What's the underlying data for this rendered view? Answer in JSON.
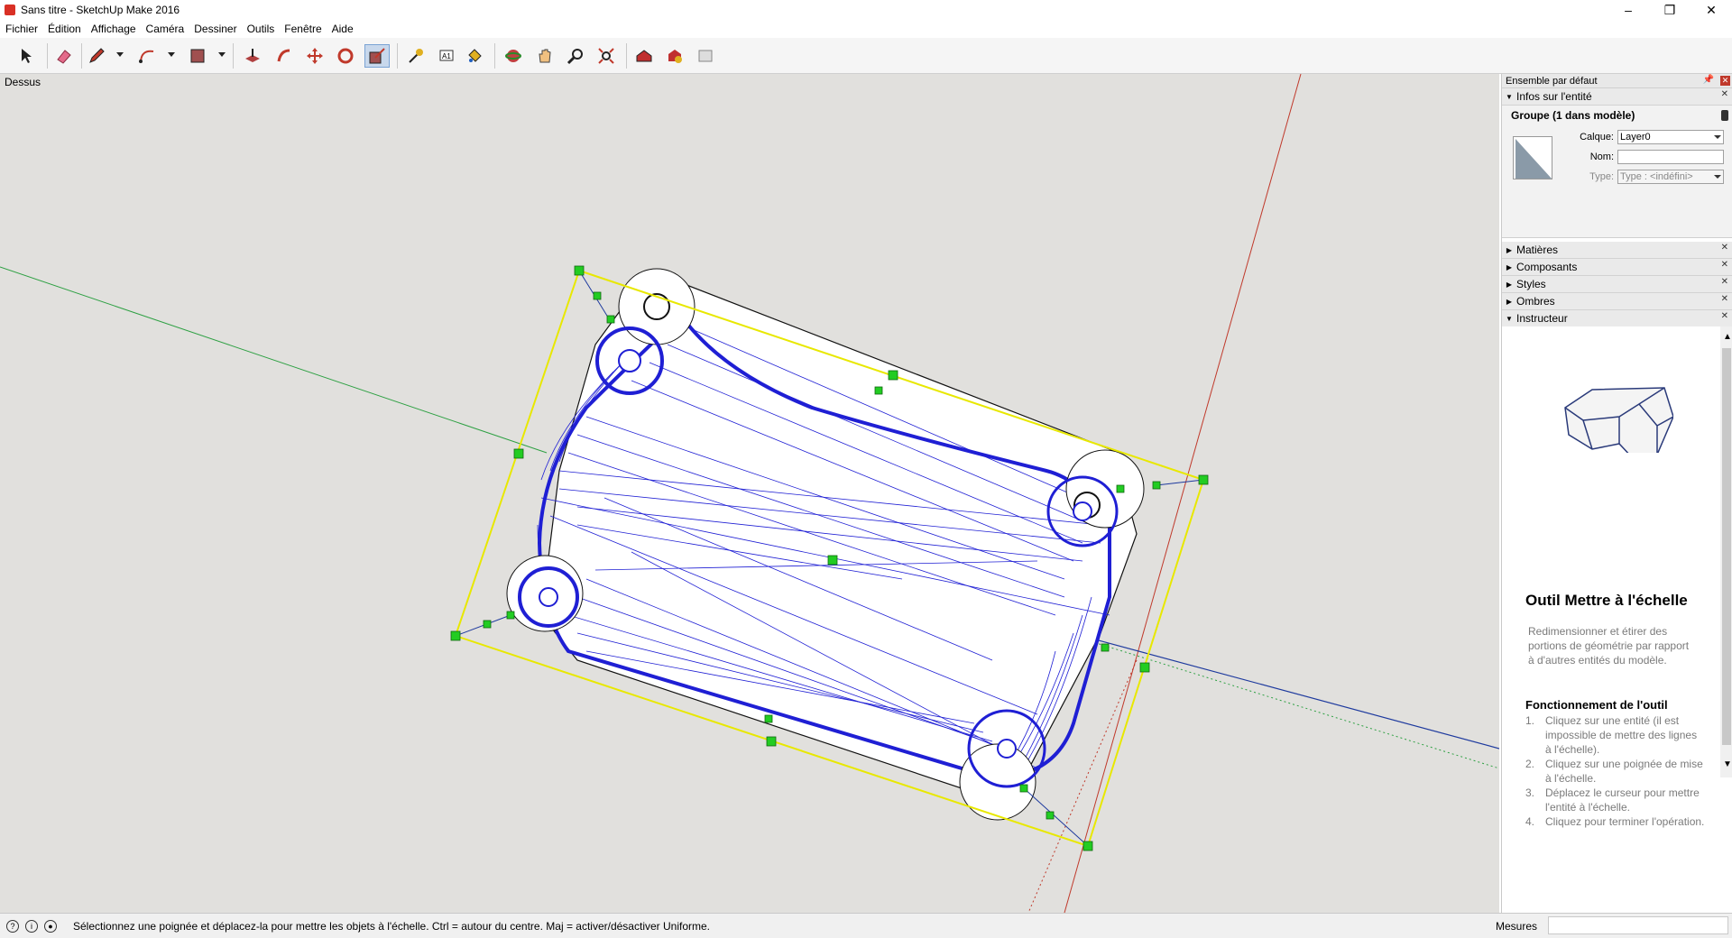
{
  "window": {
    "title": "Sans titre - SketchUp Make 2016",
    "minimize": "–",
    "maximize": "❐",
    "close": "✕"
  },
  "menu": [
    "Fichier",
    "Édition",
    "Affichage",
    "Caméra",
    "Dessiner",
    "Outils",
    "Fenêtre",
    "Aide"
  ],
  "toolbar": {
    "tools": [
      "select-icon",
      "eraser-icon",
      "pencil-icon",
      "arc-icon",
      "shape-icon",
      "pushpull-icon",
      "followme-icon",
      "move-icon",
      "rotate-icon",
      "scale-icon",
      "tape-measure-icon",
      "text-icon",
      "paint-bucket-icon",
      "orbit-icon",
      "pan-icon",
      "zoom-icon",
      "zoom-extents-icon",
      "warehouse-icon",
      "extension-icon",
      "layout-icon"
    ],
    "active_tool": "scale-icon"
  },
  "viewport": {
    "view_label": "Dessus"
  },
  "panel": {
    "tray_title": "Ensemble par défaut",
    "entity_section": "Infos sur l'entité",
    "entity_title": "Groupe (1 dans modèle)",
    "layer_label": "Calque:",
    "layer_value": "Layer0",
    "name_label": "Nom:",
    "name_value": "",
    "type_label": "Type:",
    "type_value": "Type : <indéfini>",
    "sections": [
      "Matières",
      "Composants",
      "Styles",
      "Ombres"
    ],
    "instructor_section": "Instructeur",
    "instructor": {
      "title": "Outil Mettre à l'échelle",
      "description": "Redimensionner et étirer des portions de géométrie par rapport à d'autres entités du modèle.",
      "how_title": "Fonctionnement de l'outil",
      "steps": [
        {
          "n": "1.",
          "text": "Cliquez sur une entité (il est impossible de mettre des lignes à l'échelle)."
        },
        {
          "n": "2.",
          "text": "Cliquez sur une poignée de mise à l'échelle."
        },
        {
          "n": "3.",
          "text": "Déplacez le curseur pour mettre l'entité à l'échelle."
        },
        {
          "n": "4.",
          "text": "Cliquez pour terminer l'opération."
        }
      ]
    }
  },
  "status": {
    "message": "Sélectionnez une poignée et déplacez-la pour mettre les objets à l'échelle. Ctrl = autour du centre. Maj = activer/désactiver Uniforme.",
    "measure_label": "Mesures",
    "measure_value": ""
  },
  "colors": {
    "axis_red": "#c0392b",
    "axis_green": "#2ea043",
    "axis_blue": "#1e3a9e",
    "selection_yellow": "#e8e800",
    "mesh_blue": "#1f1fd4",
    "handle_green": "#22cc22"
  }
}
